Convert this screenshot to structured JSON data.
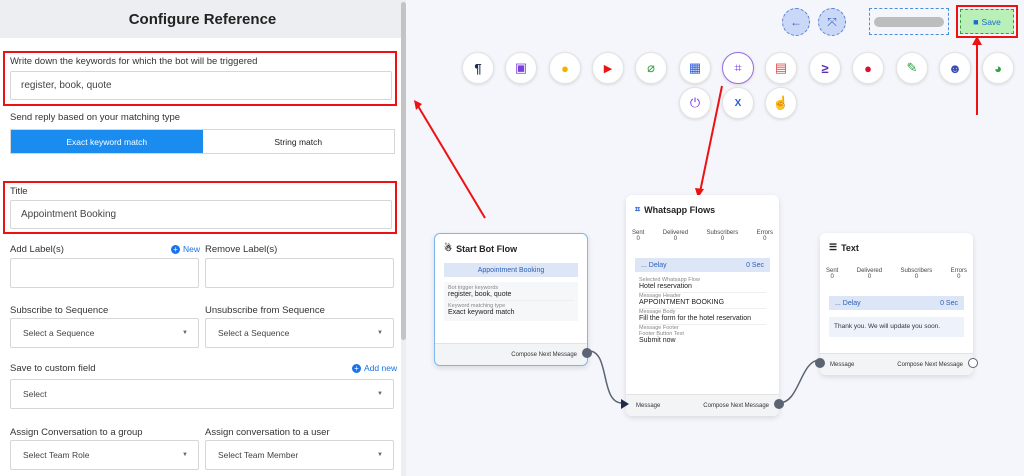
{
  "panel": {
    "title": "Configure Reference",
    "keywords_label": "Write down the keywords for which the bot will be triggered",
    "keywords_value": "register, book, quote",
    "match_label": "Send reply based on your matching type",
    "match_options": [
      "Exact keyword match",
      "String match"
    ],
    "title_label": "Title",
    "title_value": "Appointment Booking",
    "add_label": "Add Label(s)",
    "add_new": "New",
    "remove_label": "Remove Label(s)",
    "subscribe_label": "Subscribe to Sequence",
    "subscribe_value": "Select a Sequence",
    "unsubscribe_label": "Unsubscribe from Sequence",
    "unsubscribe_value": "Select a Sequence",
    "custom_field_label": "Save to custom field",
    "custom_add_new": "Add new",
    "custom_field_value": "Select",
    "group_label": "Assign Conversation to a group",
    "group_value": "Select Team Role",
    "user_label": "Assign conversation to a user",
    "user_value": "Select Team Member"
  },
  "toolbar": {
    "save_label": "Save",
    "icons": [
      "paragraph-icon",
      "image-icon",
      "microphone-icon",
      "video-icon",
      "attachment-icon",
      "map-icon",
      "whatsapp-flow-icon",
      "article-icon",
      "greater-equal-icon",
      "drop-icon",
      "signature-icon",
      "robot-icon",
      "palette-icon",
      "plug-icon",
      "excel-icon",
      "pointer-icon"
    ]
  },
  "start_node": {
    "title": "Start Bot Flow",
    "reference": "Appointment Booking",
    "keywords_lbl": "Bot trigger keywords",
    "keywords": "register, book, quote",
    "match_lbl": "Keyword matching type",
    "match": "Exact keyword match",
    "compose": "Compose Next Message"
  },
  "flow_node": {
    "title": "Whatsapp Flows",
    "stats": [
      {
        "label": "Sent",
        "value": "0"
      },
      {
        "label": "Delivered",
        "value": "0"
      },
      {
        "label": "Subscribers",
        "value": "0"
      },
      {
        "label": "Errors",
        "value": "0"
      }
    ],
    "delay_label": "... Delay",
    "delay_value": "0 Sec",
    "flow_lbl": "Selected Whatsapp Flow",
    "flow": "Hotel reservation",
    "header_lbl": "Message Header",
    "header": "APPOINTMENT BOOKING",
    "body_lbl": "Message Body",
    "body": "Fill the form for the hotel reservation",
    "footer_lbl": "Message Footer",
    "footer_btn_lbl": "Footer Button Text",
    "footer_btn": "Submit now",
    "message": "Message",
    "compose": "Compose Next Message"
  },
  "text_node": {
    "title": "Text",
    "stats": [
      {
        "label": "Sent",
        "value": "0"
      },
      {
        "label": "Delivered",
        "value": "0"
      },
      {
        "label": "Subscribers",
        "value": "0"
      },
      {
        "label": "Errors",
        "value": "0"
      }
    ],
    "delay_label": "... Delay",
    "delay_value": "0 Sec",
    "message_text": "Thank you. We will update you soon.",
    "message": "Message",
    "compose": "Compose Next Message"
  },
  "colors": {
    "accent": "#1a8cf0",
    "highlight": "#ee1111",
    "save_bg": "#b8f0b8"
  }
}
